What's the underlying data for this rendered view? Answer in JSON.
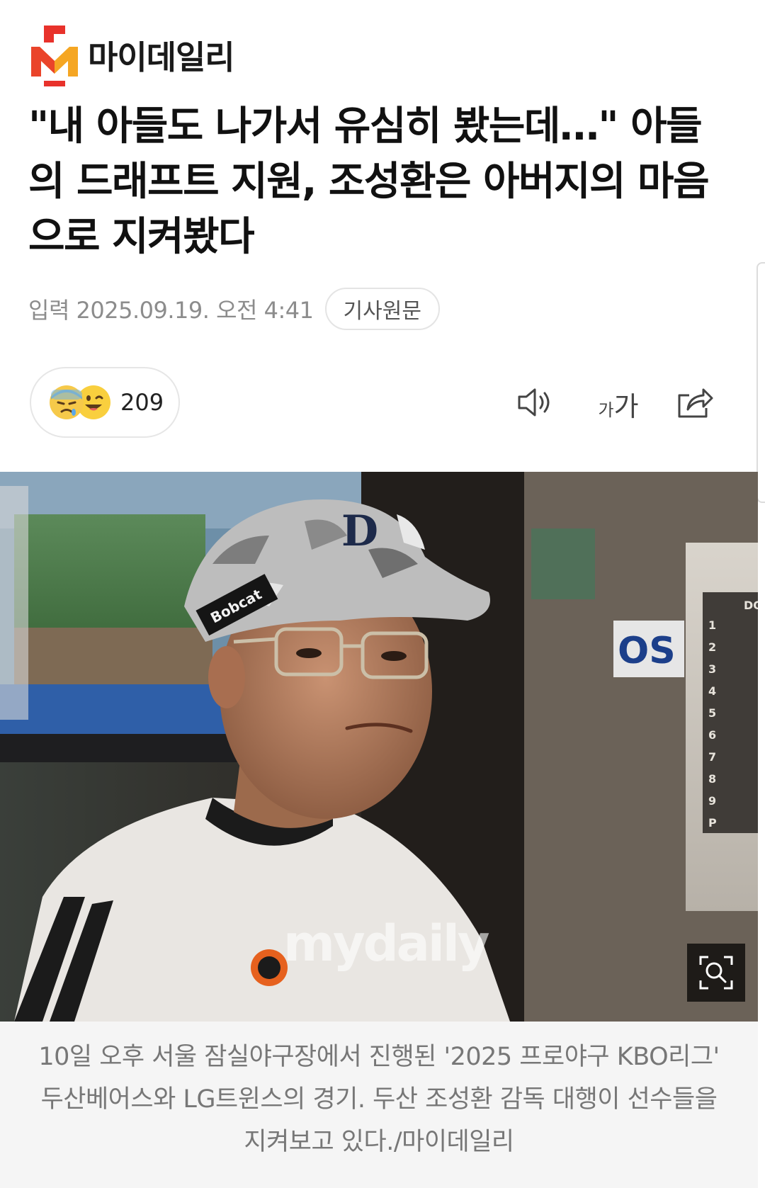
{
  "brand": {
    "name": "마이데일리"
  },
  "article": {
    "title": "\"내 아들도 나가서 유심히 봤는데…\" 아들의 드래프트 지원, 조성환은 아버지의 마음으로 지켜봤다",
    "published": "입력 2025.09.19. 오전 4:41",
    "original_button": "기사원문"
  },
  "reactions": {
    "count": "209",
    "icons": [
      "sad-face-icon",
      "grinning-face-icon"
    ]
  },
  "toolbar": {
    "icons": [
      "speaker-icon",
      "font-size-icon",
      "share-icon"
    ],
    "font_small": "가",
    "font_large": "가"
  },
  "photo": {
    "watermark": "mydaily",
    "cap_logo": "Bobcat",
    "sign_text": "OS",
    "board_header": "DOO",
    "board_numbers": [
      "1",
      "2",
      "3",
      "4",
      "5",
      "6",
      "7",
      "8",
      "9",
      "P"
    ],
    "zoom_icon": "magnify-icon"
  },
  "caption": {
    "text": "10일 오후 서울 잠실야구장에서 진행된 '2025 프로야구 KBO리그' 두산베어스와 LG트윈스의 경기. 두산 조성환 감독 대행이 선수들을 지켜보고 있다./마이데일리"
  },
  "colors": {
    "brand_red": "#e8322b",
    "brand_orange": "#f5a623",
    "date_gray": "#8c8c8c",
    "caption_bg": "#f5f5f5"
  }
}
